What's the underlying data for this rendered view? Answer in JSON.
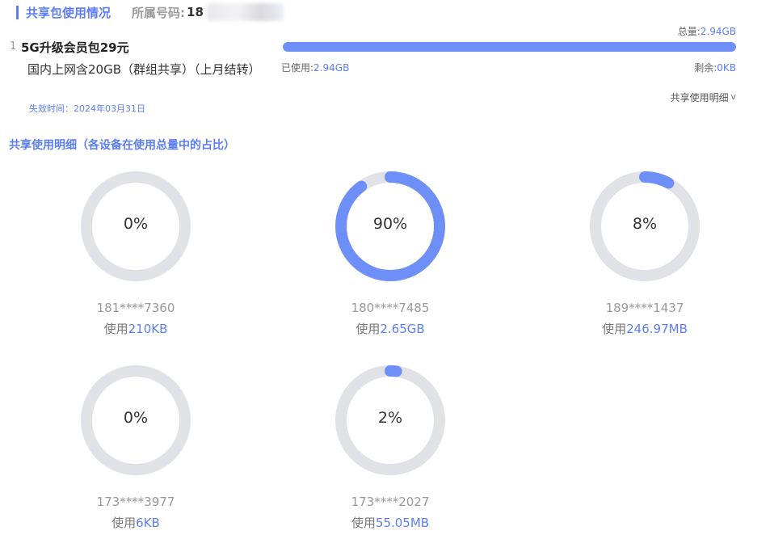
{
  "header": {
    "title": "共享包使用情况",
    "number_label": "所属号码:",
    "number_visible": "18"
  },
  "package": {
    "index": "1",
    "name": "5G升级会员包29元",
    "desc": "国内上网含20GB（群组共享）（上月结转）",
    "expiry": "失效时间：2024年03月31日"
  },
  "usage": {
    "total_label": "总量:",
    "total_value": "2.94GB",
    "used_label": "已使用:",
    "used_value": "2.94GB",
    "remain_label": "剩余:",
    "remain_value": "0KB",
    "used_fraction": 1.0,
    "detail_link": "共享使用明细"
  },
  "section_title": "共享使用明细（各设备在使用总量中的占比）",
  "colors": {
    "accent": "#5b7ef6",
    "ring_track": "#e1e2e8",
    "ring_fill": "#6f8ff8"
  },
  "devices": [
    {
      "percent_label": "0%",
      "percent": 0,
      "phone": "181****7360",
      "used_prefix": "使用",
      "used_amount": "210KB"
    },
    {
      "percent_label": "90%",
      "percent": 90,
      "phone": "180****7485",
      "used_prefix": "使用",
      "used_amount": "2.65GB"
    },
    {
      "percent_label": "8%",
      "percent": 8,
      "phone": "189****1437",
      "used_prefix": "使用",
      "used_amount": "246.97MB"
    },
    {
      "percent_label": "0%",
      "percent": 0,
      "phone": "173****3977",
      "used_prefix": "使用",
      "used_amount": "6KB"
    },
    {
      "percent_label": "2%",
      "percent": 2,
      "phone": "173****2027",
      "used_prefix": "使用",
      "used_amount": "55.05MB"
    }
  ]
}
